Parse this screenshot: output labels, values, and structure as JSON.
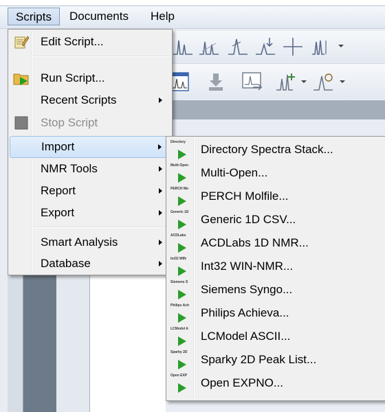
{
  "menubar": {
    "items": [
      "Scripts",
      "Documents",
      "Help"
    ]
  },
  "scripts_menu": {
    "items": [
      {
        "label": "Edit Script...",
        "icon": "edit-script-icon"
      },
      {
        "label": "Run Script...",
        "icon": "run-script-icon"
      },
      {
        "label": "Recent Scripts",
        "submenu": true
      },
      {
        "label": "Stop Script",
        "icon": "stop-script-icon",
        "disabled": true
      },
      {
        "label": "Import",
        "submenu": true,
        "highlighted": true
      },
      {
        "label": "NMR Tools",
        "submenu": true
      },
      {
        "label": "Report",
        "submenu": true
      },
      {
        "label": "Export",
        "submenu": true
      },
      {
        "label": "Smart Analysis",
        "submenu": true
      },
      {
        "label": "Database",
        "submenu": true
      }
    ]
  },
  "import_menu": {
    "items": [
      {
        "label": "Directory Spectra Stack...",
        "icon_caption": "Directory"
      },
      {
        "label": "Multi-Open...",
        "icon_caption": "Multi-Open"
      },
      {
        "label": "PERCH Molfile...",
        "icon_caption": "PERCH Mo"
      },
      {
        "label": "Generic 1D CSV...",
        "icon_caption": "Generic 1D"
      },
      {
        "label": "ACDLabs 1D NMR...",
        "icon_caption": "ACDLabs"
      },
      {
        "label": "Int32 WIN-NMR...",
        "icon_caption": "Int32 WIN"
      },
      {
        "label": "Siemens Syngo...",
        "icon_caption": "Siemens S"
      },
      {
        "label": "Philips Achieva...",
        "icon_caption": "Philips Ach"
      },
      {
        "label": "LCModel ASCII...",
        "icon_caption": "LCModel A"
      },
      {
        "label": "Sparky 2D Peak List...",
        "icon_caption": "Sparky 2D"
      },
      {
        "label": "Open EXPNO...",
        "icon_caption": "Open EXP"
      }
    ]
  },
  "colors": {
    "menu_bg": "#f0f0f0",
    "highlight": "#cfe3fa",
    "play_icon": "#2a9d2a",
    "disabled_text": "#8d8d8d"
  }
}
